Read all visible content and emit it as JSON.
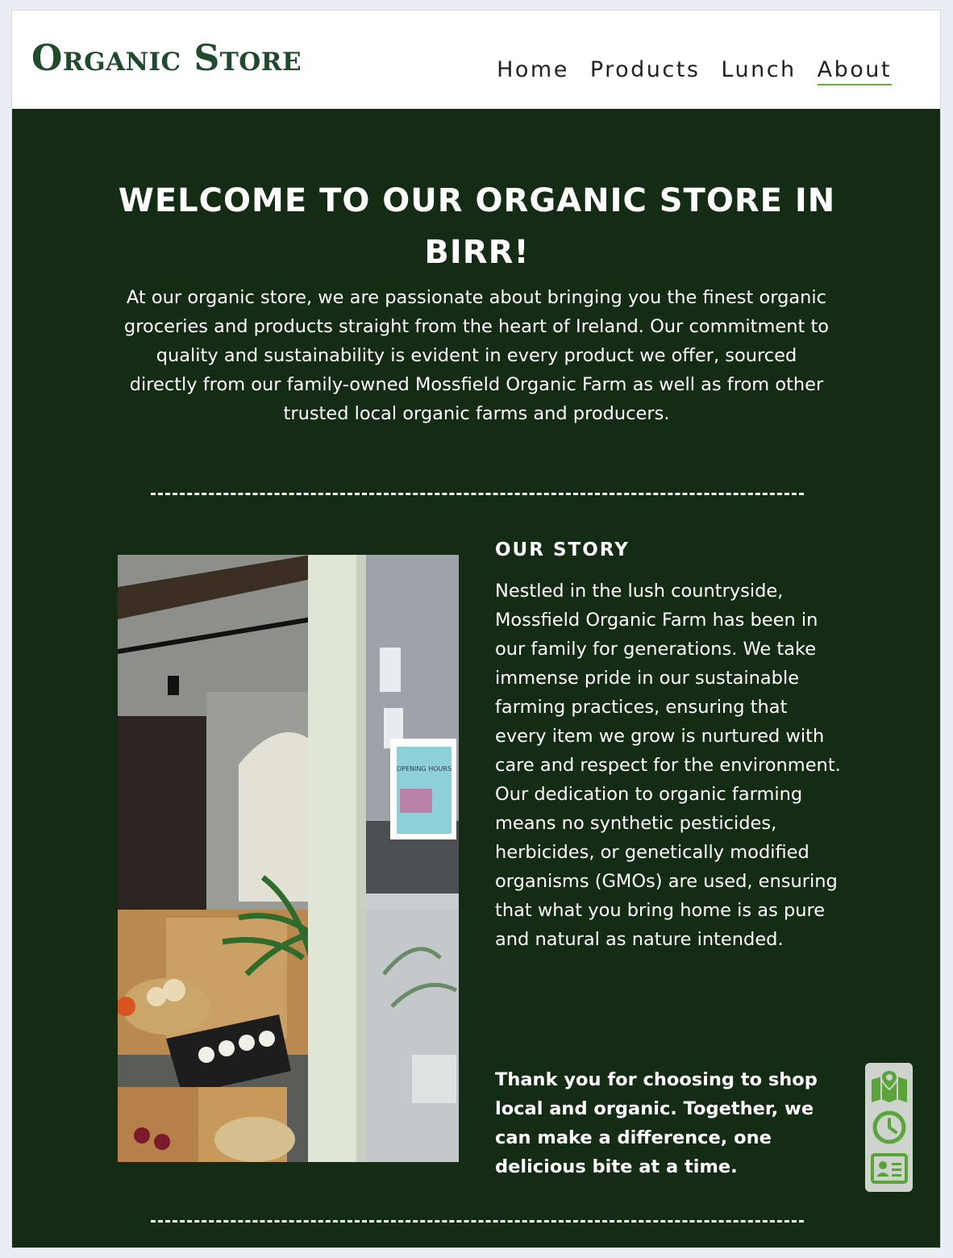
{
  "header": {
    "logo": "Organic Store",
    "nav": [
      {
        "label": "Home",
        "active": false
      },
      {
        "label": "Products",
        "active": false
      },
      {
        "label": "Lunch",
        "active": false
      },
      {
        "label": "About",
        "active": true
      }
    ]
  },
  "welcome": {
    "title": "WELCOME TO OUR ORGANIC STORE IN BIRR!",
    "intro": "At our organic store, we are passionate about bringing you the finest organic groceries and products straight from the heart of Ireland. Our commitment to quality and sustainability is evident in every product we offer, sourced directly from our family-owned Mossfield Organic Farm as well as from other trusted local organic farms and producers."
  },
  "divider": "--------------------------------------------------------------------------------------",
  "story": {
    "heading": "OUR STORY",
    "text": "Nestled in the lush countryside, Mossfield Organic Farm has been in our family for generations. We take immense pride in our sustainable farming practices, ensuring that every item we grow is nurtured with care and respect for the environment. Our dedication to organic farming means no synthetic pesticides, herbicides, or genetically modified organisms (GMOs) are used, ensuring that what you bring home is as pure and natural as nature intended.",
    "thanks": "Thank you for choosing to shop local and organic. Together, we can make a difference, one delicious bite at a time."
  },
  "photo": {
    "sign_text": "OPENING HOURS"
  },
  "widget": {
    "icons": [
      "map-icon",
      "clock-icon",
      "contact-card-icon"
    ]
  },
  "colors": {
    "header_bg": "#ffffff",
    "main_bg": "#142b14",
    "logo": "#1f4a2b",
    "accent": "#6aae3a"
  }
}
